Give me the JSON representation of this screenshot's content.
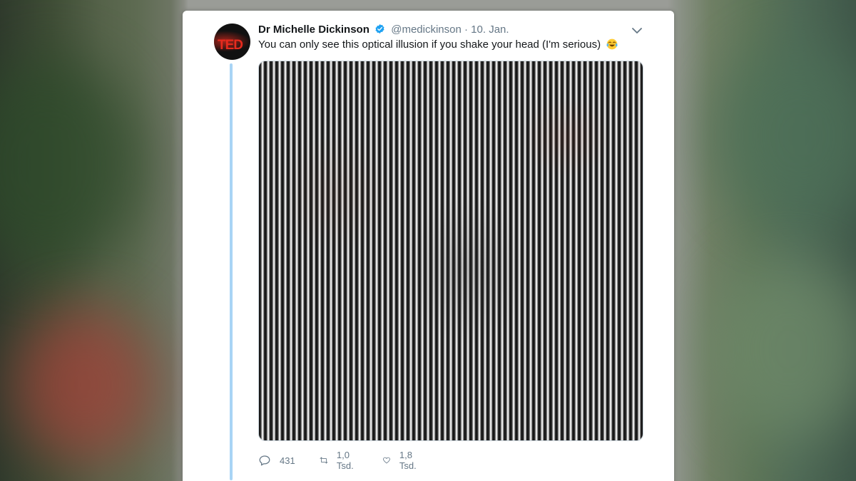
{
  "tweet": {
    "author_name": "Dr Michelle Dickinson",
    "handle": "@medickinson",
    "separator": "·",
    "date": "10. Jan.",
    "text": "You can only see this optical illusion if you shake your head (I'm serious)",
    "emoji": "face-with-tears-of-joy",
    "verified": true,
    "avatar_text": "TED"
  },
  "actions": {
    "reply_count": "431",
    "retweet_count": "1,0 Tsd.",
    "like_count": "1,8 Tsd."
  },
  "icons": {
    "verified": "verified-badge-icon",
    "menu": "chevron-down-icon",
    "reply": "reply-icon",
    "retweet": "retweet-icon",
    "like": "heart-icon"
  },
  "colors": {
    "verified_blue": "#1da1f2",
    "thread_line": "#a8d4f5",
    "secondary_text": "#657786",
    "primary_text": "#14171a",
    "ted_red": "#e62b1e"
  }
}
